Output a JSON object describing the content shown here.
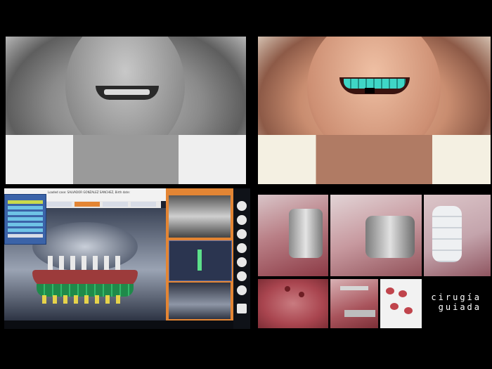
{
  "caption": {
    "line1": "cirugía",
    "line2": "guiada"
  },
  "software": {
    "window_title": "Loaded case: SALVADOR GONZALEZ SANCHEZ, Birth date:",
    "tabs": [
      "",
      "",
      "",
      ""
    ]
  },
  "colors": {
    "background": "#000000",
    "software_accent": "#e38534",
    "teeth_highlight": "#3fd6c6"
  }
}
